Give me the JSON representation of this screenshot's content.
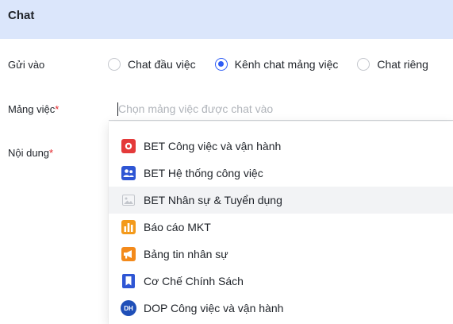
{
  "header": {
    "title": "Chat"
  },
  "send_to": {
    "label": "Gửi vào",
    "options": [
      {
        "label": "Chat đầu việc",
        "checked": false
      },
      {
        "label": "Kênh chat mảng việc",
        "checked": true
      },
      {
        "label": "Chat riêng",
        "checked": false
      }
    ]
  },
  "work_area": {
    "label": "Mảng việc",
    "required_mark": "*",
    "placeholder": "Chọn mảng việc được chat vào"
  },
  "content": {
    "label": "Nội dung",
    "required_mark": "*"
  },
  "dropdown": {
    "items": [
      {
        "label": "BET Công việc và vận hành",
        "icon": "red-badge-icon"
      },
      {
        "label": "BET Hệ thống công việc",
        "icon": "team-people-icon"
      },
      {
        "label": "BET Nhân sự & Tuyển dụng",
        "icon": "image-placeholder-icon"
      },
      {
        "label": "Báo cáo MKT",
        "icon": "bar-chart-icon"
      },
      {
        "label": "Bảng tin nhân sự",
        "icon": "megaphone-icon"
      },
      {
        "label": "Cơ Chế Chính Sách",
        "icon": "bookmark-icon"
      },
      {
        "label": "DOP Công việc và vận hành",
        "icon": "dh-avatar-icon",
        "icon_text": "DH"
      }
    ]
  },
  "colors": {
    "header_bg": "#dbe6fb",
    "accent": "#2e5cf5",
    "required": "#e3262b"
  }
}
